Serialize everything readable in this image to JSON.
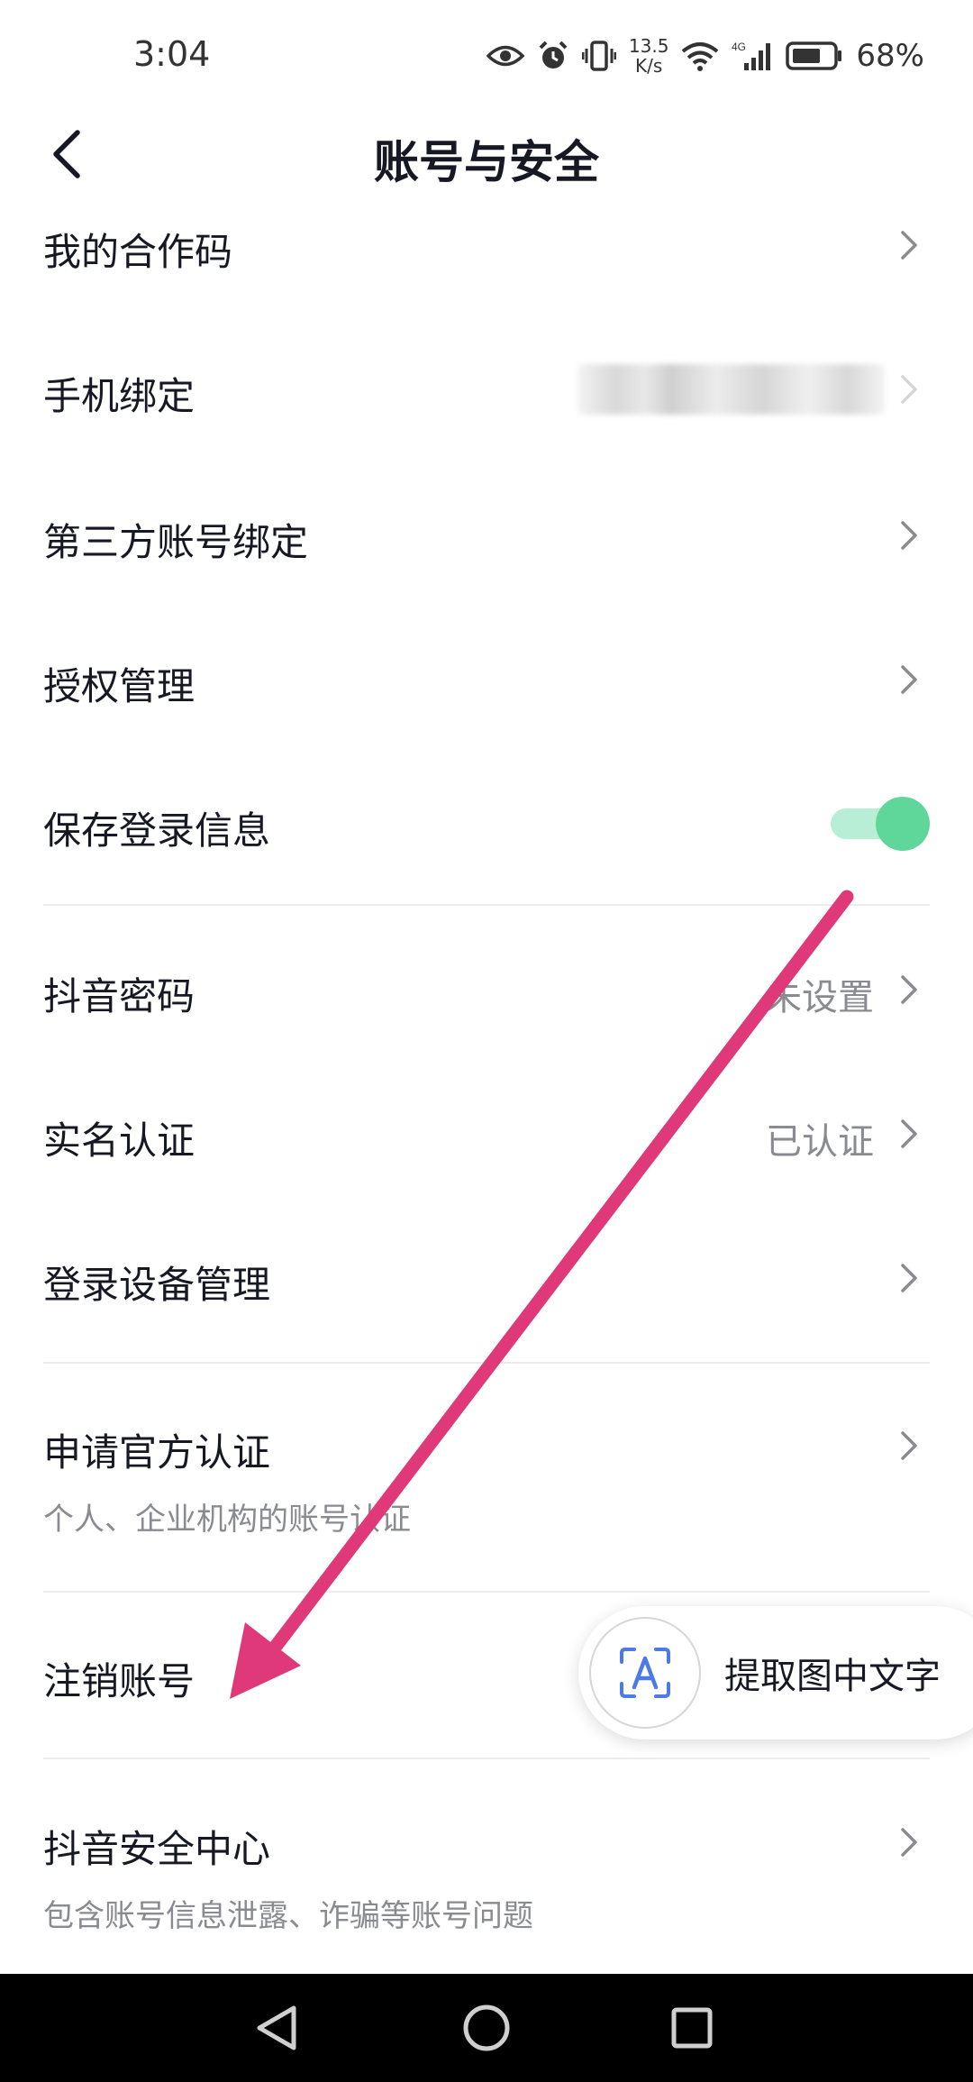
{
  "status_bar": {
    "time": "3:04",
    "net_speed_value": "13.5",
    "net_speed_unit": "K/s",
    "network_type": "4G",
    "battery_percent": "68%"
  },
  "header": {
    "title": "账号与安全"
  },
  "items": {
    "cooperation_code": {
      "label": "我的合作码"
    },
    "phone_binding": {
      "label": "手机绑定"
    },
    "third_party_binding": {
      "label": "第三方账号绑定"
    },
    "authorization": {
      "label": "授权管理"
    },
    "save_login": {
      "label": "保存登录信息",
      "enabled": true
    },
    "password": {
      "label": "抖音密码",
      "value": "未设置"
    },
    "real_name": {
      "label": "实名认证",
      "value": "已认证"
    },
    "devices": {
      "label": "登录设备管理"
    },
    "official_verify": {
      "label": "申请官方认证",
      "subtitle": "个人、企业机构的账号认证"
    },
    "deactivate": {
      "label": "注销账号"
    },
    "security_center": {
      "label": "抖音安全中心",
      "subtitle": "包含账号信息泄露、诈骗等账号问题"
    }
  },
  "ocr_button": {
    "label": "提取图中文字"
  },
  "colors": {
    "accent_toggle": "#5fd79a",
    "annotation_arrow": "#e0397a",
    "secondary_text": "#8a8b91"
  }
}
